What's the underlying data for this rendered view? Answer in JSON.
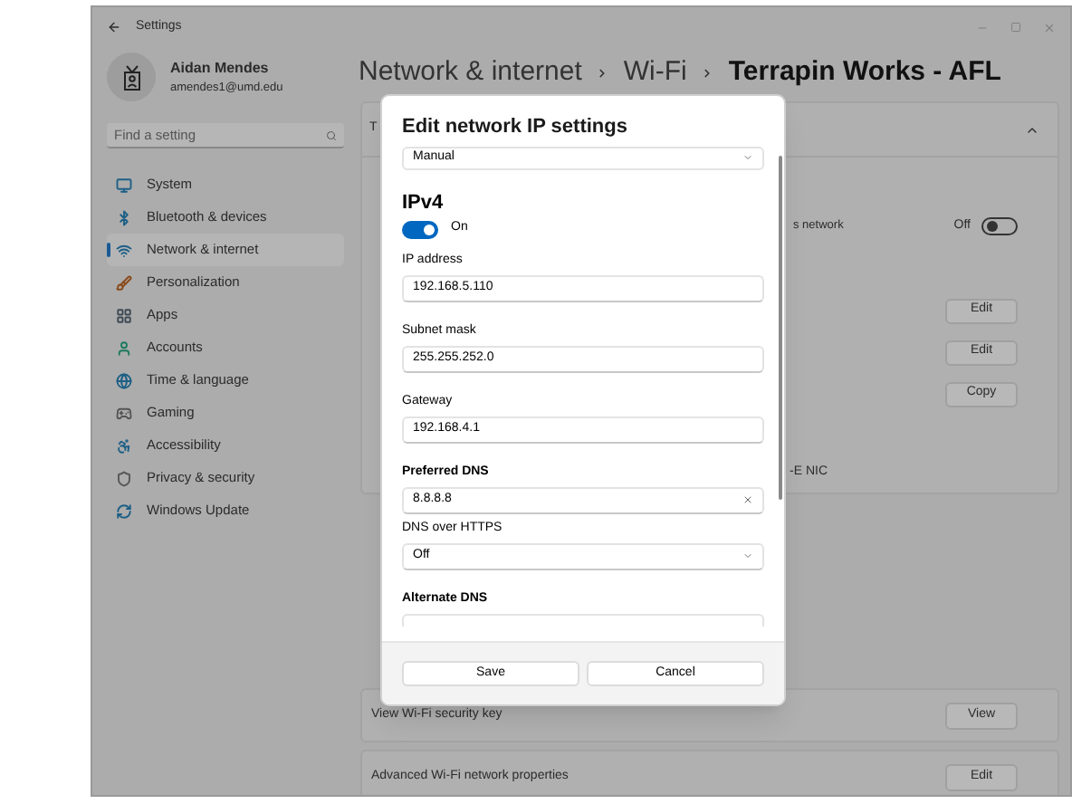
{
  "window": {
    "title": "Settings"
  },
  "user": {
    "name": "Aidan Mendes",
    "email": "amendes1@umd.edu"
  },
  "search": {
    "placeholder": "Find a setting"
  },
  "nav": [
    {
      "label": "System",
      "selected": false
    },
    {
      "label": "Bluetooth & devices",
      "selected": false
    },
    {
      "label": "Network & internet",
      "selected": true
    },
    {
      "label": "Personalization",
      "selected": false
    },
    {
      "label": "Apps",
      "selected": false
    },
    {
      "label": "Accounts",
      "selected": false
    },
    {
      "label": "Time & language",
      "selected": false
    },
    {
      "label": "Gaming",
      "selected": false
    },
    {
      "label": "Accessibility",
      "selected": false
    },
    {
      "label": "Privacy & security",
      "selected": false
    },
    {
      "label": "Windows Update",
      "selected": false
    }
  ],
  "breadcrumb": [
    "Network & internet",
    "Wi-Fi",
    "Terrapin Works - AFL"
  ],
  "background": {
    "card_header": "T",
    "toggle_row": {
      "text": "s network",
      "state_label": "Off",
      "on": false
    },
    "action_buttons": [
      "Edit",
      "Edit",
      "Copy"
    ],
    "adapter_text": "-E NIC",
    "rows": [
      {
        "label": "View Wi-Fi security key",
        "button": "View"
      },
      {
        "label": "Advanced Wi-Fi network properties",
        "button": "Edit"
      }
    ]
  },
  "dialog": {
    "title": "Edit network IP settings",
    "mode": "Manual",
    "section": "IPv4",
    "toggle": {
      "on": true,
      "label": "On"
    },
    "fields": [
      {
        "kind": "input",
        "label": "IP address",
        "value": "192.168.5.110",
        "emphasized": false
      },
      {
        "kind": "input",
        "label": "Subnet mask",
        "value": "255.255.252.0",
        "emphasized": false
      },
      {
        "kind": "input",
        "label": "Gateway",
        "value": "192.168.4.1",
        "emphasized": false
      },
      {
        "kind": "input",
        "label": "Preferred DNS",
        "value": "8.8.8.8",
        "emphasized": true,
        "clear_button": true
      },
      {
        "kind": "select",
        "label": "DNS over HTTPS",
        "value": "Off",
        "emphasized": false
      },
      {
        "kind": "input",
        "label": "Alternate DNS",
        "emphasized": true
      }
    ],
    "buttons": [
      "Save",
      "Cancel"
    ]
  }
}
